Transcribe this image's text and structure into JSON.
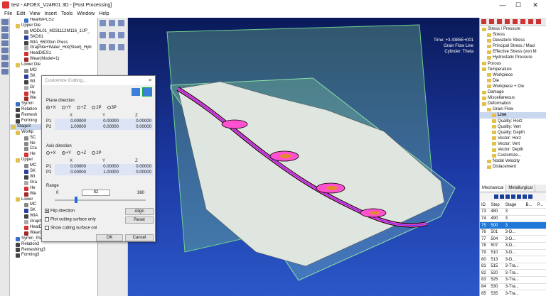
{
  "window": {
    "title": "test - AFDEX_V24R01 3D - [Post Processing]",
    "minimize": "—",
    "maximize": "☐",
    "close": "✕"
  },
  "menu": [
    "File",
    "Edit",
    "View",
    "Insert",
    "Tools",
    "Window",
    "Help"
  ],
  "tree": {
    "rows": [
      {
        "label": "HeatWPCS2",
        "indent": 3,
        "color": "#3a6fc9"
      },
      {
        "label": "Upper Die",
        "indent": 1,
        "color": "#e2c14a"
      },
      {
        "label": "MODL01_M231112M116_1UP_",
        "indent": 3,
        "color": "#888888"
      },
      {
        "label": "SKD61",
        "indent": 3,
        "color": "#2b3fa0"
      },
      {
        "label": "WIA_6500ton Press",
        "indent": 3,
        "color": "#444444"
      },
      {
        "label": "Graphite+Water_Hot(Steel)_Hyb",
        "indent": 3,
        "color": "#aaaaaa"
      },
      {
        "label": "HeatDIES1",
        "indent": 3,
        "color": "#d33333"
      },
      {
        "label": "Wear(Model=1)",
        "indent": 3,
        "color": "#a02828"
      },
      {
        "label": "Lower Die",
        "indent": 1,
        "color": "#e2c14a"
      },
      {
        "label": "MO",
        "indent": 3,
        "color": "#888888"
      },
      {
        "label": "SK",
        "indent": 3,
        "color": "#2b3fa0"
      },
      {
        "label": "WI",
        "indent": 3,
        "color": "#444444"
      },
      {
        "label": "Gr",
        "indent": 3,
        "color": "#aaaaaa"
      },
      {
        "label": "He",
        "indent": 3,
        "color": "#d33333"
      },
      {
        "label": "We",
        "indent": 3,
        "color": "#a02828"
      },
      {
        "label": "Symm",
        "indent": 1,
        "color": "#3a6fc9"
      },
      {
        "label": "Relation",
        "indent": 1,
        "color": "#444444"
      },
      {
        "label": "Remesh",
        "indent": 1,
        "color": "#444444"
      },
      {
        "label": "Forming",
        "indent": 1,
        "color": "#444444"
      },
      {
        "label": "Stage3",
        "indent": 0,
        "color": "#e2c14a",
        "selected": true
      },
      {
        "label": "Workp",
        "indent": 1,
        "color": "#e2c14a"
      },
      {
        "label": "SC",
        "indent": 3,
        "color": "#888888"
      },
      {
        "label": "Ne",
        "indent": 3,
        "color": "#888888"
      },
      {
        "label": "Cra",
        "indent": 3,
        "color": "#888888"
      },
      {
        "label": "He",
        "indent": 3,
        "color": "#d33333"
      },
      {
        "label": "Upper",
        "indent": 1,
        "color": "#e2c14a"
      },
      {
        "label": "MC",
        "indent": 3,
        "color": "#888888"
      },
      {
        "label": "SK",
        "indent": 3,
        "color": "#2b3fa0"
      },
      {
        "label": "WI",
        "indent": 3,
        "color": "#444444"
      },
      {
        "label": "Gra",
        "indent": 3,
        "color": "#aaaaaa"
      },
      {
        "label": "He",
        "indent": 3,
        "color": "#d33333"
      },
      {
        "label": "We",
        "indent": 3,
        "color": "#a02828"
      },
      {
        "label": "Lower",
        "indent": 1,
        "color": "#e2c14a"
      },
      {
        "label": "MC",
        "indent": 3,
        "color": "#888888"
      },
      {
        "label": "SK",
        "indent": 3,
        "color": "#2b3fa0"
      },
      {
        "label": "WIA",
        "indent": 3,
        "color": "#444444"
      },
      {
        "label": "Graphite+Water_Hot(Steel)_Hyb",
        "indent": 3,
        "color": "#aaaaaa"
      },
      {
        "label": "HeatDIES4",
        "indent": 3,
        "color": "#d33333"
      },
      {
        "label": "Wear(Model=1)",
        "indent": 3,
        "color": "#a02828"
      },
      {
        "label": "Symm_Plane (0)",
        "indent": 1,
        "color": "#3a6fc9"
      },
      {
        "label": "Relation3",
        "indent": 1,
        "color": "#444444"
      },
      {
        "label": "Remeshing3",
        "indent": 1,
        "color": "#444444"
      },
      {
        "label": "Forming3",
        "indent": 1,
        "color": "#444444"
      }
    ]
  },
  "viewport": {
    "time": "Time: +3.4385E+001",
    "mode": "Grain Flow Line",
    "cylinder": "Cylinder: Theta"
  },
  "dialog": {
    "title": "Customize Cutting...",
    "close": "✕",
    "plane_direction": "Plane direction",
    "plane_options": [
      "+X",
      "+Y",
      "+Z",
      "2P",
      "3P"
    ],
    "plane_selected": 0,
    "cols": [
      "X",
      "Y",
      "Z"
    ],
    "plane_rows": [
      {
        "label": "P1",
        "x": "0.00000",
        "y": "0.00000",
        "z": "0.00000"
      },
      {
        "label": "P2",
        "x": "1.00000",
        "y": "0.00000",
        "z": "0.00000"
      }
    ],
    "axis_direction": "Axis direction",
    "axis_options": [
      "+X",
      "+Y",
      "+Z",
      "2P"
    ],
    "axis_selected": 1,
    "axis_rows": [
      {
        "label": "P1",
        "x": "0.00000",
        "y": "0.00000",
        "z": "0.00000"
      },
      {
        "label": "P2",
        "x": "0.00000",
        "y": "1.00000",
        "z": "0.00000"
      }
    ],
    "range": "Range",
    "range_min": "0",
    "range_value": "82",
    "range_max": "360",
    "flip": "Flip direction",
    "align": "Align",
    "plot": "Plot cutting surface only",
    "reset": "Reset",
    "show": "Show cutting surface onl",
    "ok": "OK",
    "cancel": "Cancel"
  },
  "right": {
    "rows": [
      {
        "label": "Stress / Pressure",
        "indent": 0
      },
      {
        "label": "Stress",
        "indent": 1
      },
      {
        "label": "Deviatoric Stress",
        "indent": 1
      },
      {
        "label": "Principal Stress / Maxi",
        "indent": 1
      },
      {
        "label": "Effective Stress (von M",
        "indent": 1
      },
      {
        "label": "Hydrostatic Pressure",
        "indent": 1
      },
      {
        "label": "Porous",
        "indent": 0
      },
      {
        "label": "Temperature",
        "indent": 0
      },
      {
        "label": "Workpiece",
        "indent": 1
      },
      {
        "label": "Die",
        "indent": 1
      },
      {
        "label": "Workpiece + Die",
        "indent": 1
      },
      {
        "label": "Damage",
        "indent": 0
      },
      {
        "label": "Miscellaneous",
        "indent": 0
      },
      {
        "label": "Deformation",
        "indent": 0
      },
      {
        "label": "Grain Flow",
        "indent": 1
      },
      {
        "label": "Line",
        "indent": 2,
        "selected": true
      },
      {
        "label": "Quality: Horz",
        "indent": 2
      },
      {
        "label": "Quality: Vert",
        "indent": 2
      },
      {
        "label": "Quality: Depth",
        "indent": 2
      },
      {
        "label": "Vector: Horz",
        "indent": 2
      },
      {
        "label": "Vector: Vert",
        "indent": 2
      },
      {
        "label": "Vector: Depth",
        "indent": 2
      },
      {
        "label": "Customize...",
        "indent": 2
      },
      {
        "label": "Nodal Velocity",
        "indent": 1
      },
      {
        "label": "Dislacement",
        "indent": 1
      }
    ],
    "tabs": [
      "Mechanical",
      "Metallurgical"
    ],
    "table_headers": [
      "ID",
      "Step",
      "Stage",
      "B...",
      "P..."
    ],
    "table": [
      {
        "id": "73",
        "step": "480",
        "stage": "3",
        "hl": false
      },
      {
        "id": "74",
        "step": "490",
        "stage": "3",
        "hl": false
      },
      {
        "id": "75",
        "step": "500",
        "stage": "3",
        "hl": true
      },
      {
        "id": "76",
        "step": "501",
        "stage": "3-D...",
        "hl": false
      },
      {
        "id": "77",
        "step": "504",
        "stage": "3-D...",
        "hl": false
      },
      {
        "id": "78",
        "step": "507",
        "stage": "3-D...",
        "hl": false
      },
      {
        "id": "79",
        "step": "510",
        "stage": "3-D...",
        "hl": false
      },
      {
        "id": "80",
        "step": "513",
        "stage": "3-D...",
        "hl": false
      },
      {
        "id": "81",
        "step": "515",
        "stage": "3-Tra...",
        "hl": false
      },
      {
        "id": "82",
        "step": "520",
        "stage": "3-Tra...",
        "hl": false
      },
      {
        "id": "83",
        "step": "525",
        "stage": "3-Tra...",
        "hl": false
      },
      {
        "id": "84",
        "step": "530",
        "stage": "3-Tra...",
        "hl": false
      },
      {
        "id": "85",
        "step": "535",
        "stage": "3-Tra...",
        "hl": false
      }
    ]
  }
}
